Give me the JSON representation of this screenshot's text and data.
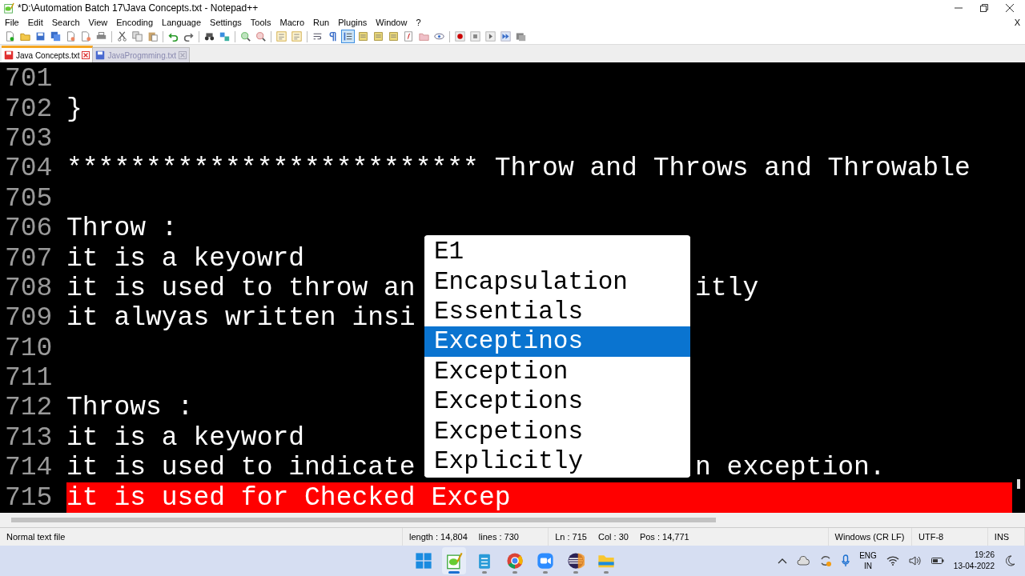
{
  "window": {
    "title": "*D:\\Automation Batch 17\\Java Concepts.txt - Notepad++"
  },
  "menu": [
    "File",
    "Edit",
    "Search",
    "View",
    "Encoding",
    "Language",
    "Settings",
    "Tools",
    "Macro",
    "Run",
    "Plugins",
    "Window",
    "?"
  ],
  "menu_close": "X",
  "toolbar": [
    {
      "kind": "new",
      "pressed": false
    },
    {
      "kind": "open",
      "pressed": false
    },
    {
      "kind": "save",
      "pressed": false
    },
    {
      "kind": "saveall",
      "pressed": false
    },
    {
      "kind": "close",
      "pressed": false
    },
    {
      "kind": "closeall",
      "pressed": false
    },
    {
      "kind": "print",
      "pressed": false
    },
    {
      "kind": "sep"
    },
    {
      "kind": "cut",
      "pressed": false
    },
    {
      "kind": "copy",
      "pressed": false
    },
    {
      "kind": "paste",
      "pressed": false
    },
    {
      "kind": "sep"
    },
    {
      "kind": "undo",
      "pressed": false
    },
    {
      "kind": "redo",
      "pressed": false
    },
    {
      "kind": "sep"
    },
    {
      "kind": "find",
      "pressed": false
    },
    {
      "kind": "replace",
      "pressed": false
    },
    {
      "kind": "sep"
    },
    {
      "kind": "zoomin",
      "pressed": false
    },
    {
      "kind": "zoomout",
      "pressed": false
    },
    {
      "kind": "sep"
    },
    {
      "kind": "sync",
      "pressed": false
    },
    {
      "kind": "sync",
      "pressed": false
    },
    {
      "kind": "sep"
    },
    {
      "kind": "wrap",
      "pressed": false
    },
    {
      "kind": "pilcrow",
      "pressed": false
    },
    {
      "kind": "indent",
      "pressed": true
    },
    {
      "kind": "doc",
      "pressed": false
    },
    {
      "kind": "doc",
      "pressed": false
    },
    {
      "kind": "doc",
      "pressed": false
    },
    {
      "kind": "func",
      "pressed": false
    },
    {
      "kind": "folder",
      "pressed": false
    },
    {
      "kind": "eye",
      "pressed": false
    },
    {
      "kind": "sep"
    },
    {
      "kind": "record",
      "pressed": false
    },
    {
      "kind": "stop",
      "pressed": false
    },
    {
      "kind": "play",
      "pressed": false
    },
    {
      "kind": "playmulti",
      "pressed": false
    },
    {
      "kind": "savemacro",
      "pressed": false
    }
  ],
  "tabs": [
    {
      "label": "Java Concepts.txt",
      "selected": true,
      "modified": true
    },
    {
      "label": "JavaProgmming.txt",
      "selected": false,
      "modified": false
    }
  ],
  "editor": {
    "lines": [
      {
        "number": "701",
        "highlighted": false
      },
      {
        "number": "702",
        "text": "}",
        "highlighted": false
      },
      {
        "number": "703",
        "highlighted": false
      },
      {
        "number": "704",
        "text": "************************** Throw and Throws and Throwable",
        "highlighted": false
      },
      {
        "number": "705",
        "highlighted": false
      },
      {
        "number": "706",
        "text": "Throw :",
        "highlighted": false
      },
      {
        "number": "707",
        "text": "it is a keyowrd",
        "highlighted": false
      },
      {
        "number": "708",
        "text": "it is used to throw an",
        "tail": "itly",
        "highlighted": false
      },
      {
        "number": "709",
        "text": "it alwyas written insi",
        "highlighted": false
      },
      {
        "number": "710",
        "highlighted": false
      },
      {
        "number": "711",
        "highlighted": false
      },
      {
        "number": "712",
        "text": "Throws :",
        "highlighted": false
      },
      {
        "number": "713",
        "text": "it is a keyword",
        "highlighted": false
      },
      {
        "number": "714",
        "text": "it is used to indicate",
        "tail": "n exception.",
        "highlighted": false
      },
      {
        "number": "715",
        "text": "it is used for Checked Excep",
        "highlighted": true
      }
    ],
    "autocomplete": [
      {
        "label": "E1",
        "selected": false
      },
      {
        "label": "Encapsulation",
        "selected": false
      },
      {
        "label": "Essentials",
        "selected": false
      },
      {
        "label": "Exceptinos",
        "selected": true
      },
      {
        "label": "Exception",
        "selected": false
      },
      {
        "label": "Exceptions",
        "selected": false
      },
      {
        "label": "Excpetions",
        "selected": false
      },
      {
        "label": "Explicitly",
        "selected": false
      }
    ]
  },
  "status_bar": {
    "type": "Normal text file",
    "length": "length : 14,804",
    "lines": "lines : 730",
    "ln": "Ln : 715",
    "col": "Col : 30",
    "pos": "Pos : 14,771",
    "eol": "Windows (CR LF)",
    "encoding": "UTF-8",
    "mode": "INS"
  },
  "taskbar": {
    "apps": [
      {
        "kind": "start",
        "running": false
      },
      {
        "kind": "notepadpp",
        "running": true
      },
      {
        "kind": "notepad",
        "running": true
      },
      {
        "kind": "chrome",
        "running": true
      },
      {
        "kind": "zoom",
        "running": true
      },
      {
        "kind": "eclipse",
        "running": true
      },
      {
        "kind": "explorer",
        "running": true
      }
    ],
    "language": "ENG",
    "region": "IN",
    "time": "19:26",
    "date": "13-04-2022"
  }
}
